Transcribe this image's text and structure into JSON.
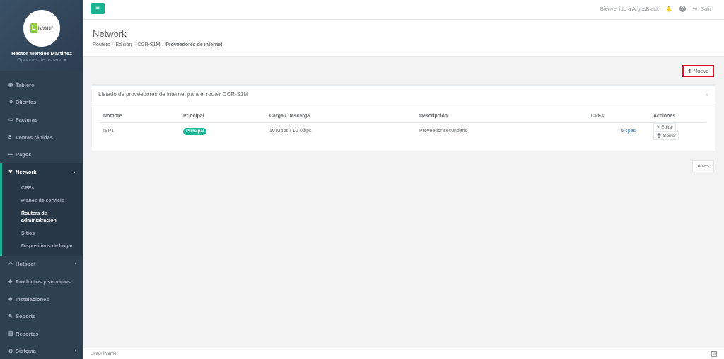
{
  "sidebar": {
    "logo_letter": "L",
    "logo_text": "ivaur",
    "user_name": "Hector Mendez Martinez",
    "user_options": "Opciones de usuario ▾",
    "items": [
      {
        "label": "Tablero",
        "icon": "dashboard-icon",
        "glyph": "◉"
      },
      {
        "label": "Clientes",
        "icon": "users-icon",
        "glyph": "☻"
      },
      {
        "label": "Facturas",
        "icon": "file-icon",
        "glyph": "▭"
      },
      {
        "label": "Ventas rápidas",
        "icon": "dollar-icon",
        "glyph": "$"
      },
      {
        "label": "Pagos",
        "icon": "monitor-icon",
        "glyph": "▬"
      },
      {
        "label": "Network",
        "icon": "snowflake-icon",
        "glyph": "❄",
        "chevron": "⌄"
      },
      {
        "label": "Hotspot",
        "icon": "wifi-icon",
        "glyph": "◠",
        "chevron": "‹"
      },
      {
        "label": "Productos y servicios",
        "icon": "tag-icon",
        "glyph": "◆"
      },
      {
        "label": "Instalaciones",
        "icon": "diamond-icon",
        "glyph": "◆"
      },
      {
        "label": "Soporte",
        "icon": "wrench-icon",
        "glyph": "✎"
      },
      {
        "label": "Reportes",
        "icon": "book-icon",
        "glyph": "▤"
      },
      {
        "label": "Sistema",
        "icon": "cogs-icon",
        "glyph": "⚙",
        "chevron": "‹"
      }
    ],
    "network_sub": [
      {
        "label": "CPEs"
      },
      {
        "label": "Planes de servicio"
      },
      {
        "label": "Routers de administración"
      },
      {
        "label": "Sitios"
      },
      {
        "label": "Dispositivos de hogar"
      }
    ]
  },
  "topbar": {
    "menu_glyph": "≡",
    "welcome": "Bienvenido a ArgusBlack",
    "bell_glyph": "🔔",
    "help_glyph": "?",
    "logout_glyph": "⇥",
    "logout_label": "Salir"
  },
  "heading": {
    "title": "Network",
    "breadcrumb": [
      "Routers",
      "Edición",
      "CCR-S1M",
      "Proveedores de internet"
    ],
    "sep": "/"
  },
  "actions": {
    "new_label": "✚ Nuevo",
    "back_label": "Atras"
  },
  "panel": {
    "title": "Listado de proveedores de internet para el router CCR-S1M",
    "close_glyph": "×",
    "columns": [
      "Nombre",
      "Principal",
      "Carga / Descarga",
      "Descripción",
      "CPEs",
      "Acciones"
    ],
    "rows": [
      {
        "name": "ISP1",
        "principal": "Principal",
        "rate": "10 Mbps / 10 Mbps",
        "description": "Proveedor secundario",
        "cpes": "6 cpes",
        "edit_label": "✎ Editar",
        "delete_label": "🗑 Borrar"
      }
    ]
  },
  "footer": {
    "text": "Livaur Internet",
    "icon_glyph": "▤"
  },
  "colors": {
    "accent": "#1ab394",
    "sidebar": "#2f4050",
    "highlight": "#e0112b"
  }
}
